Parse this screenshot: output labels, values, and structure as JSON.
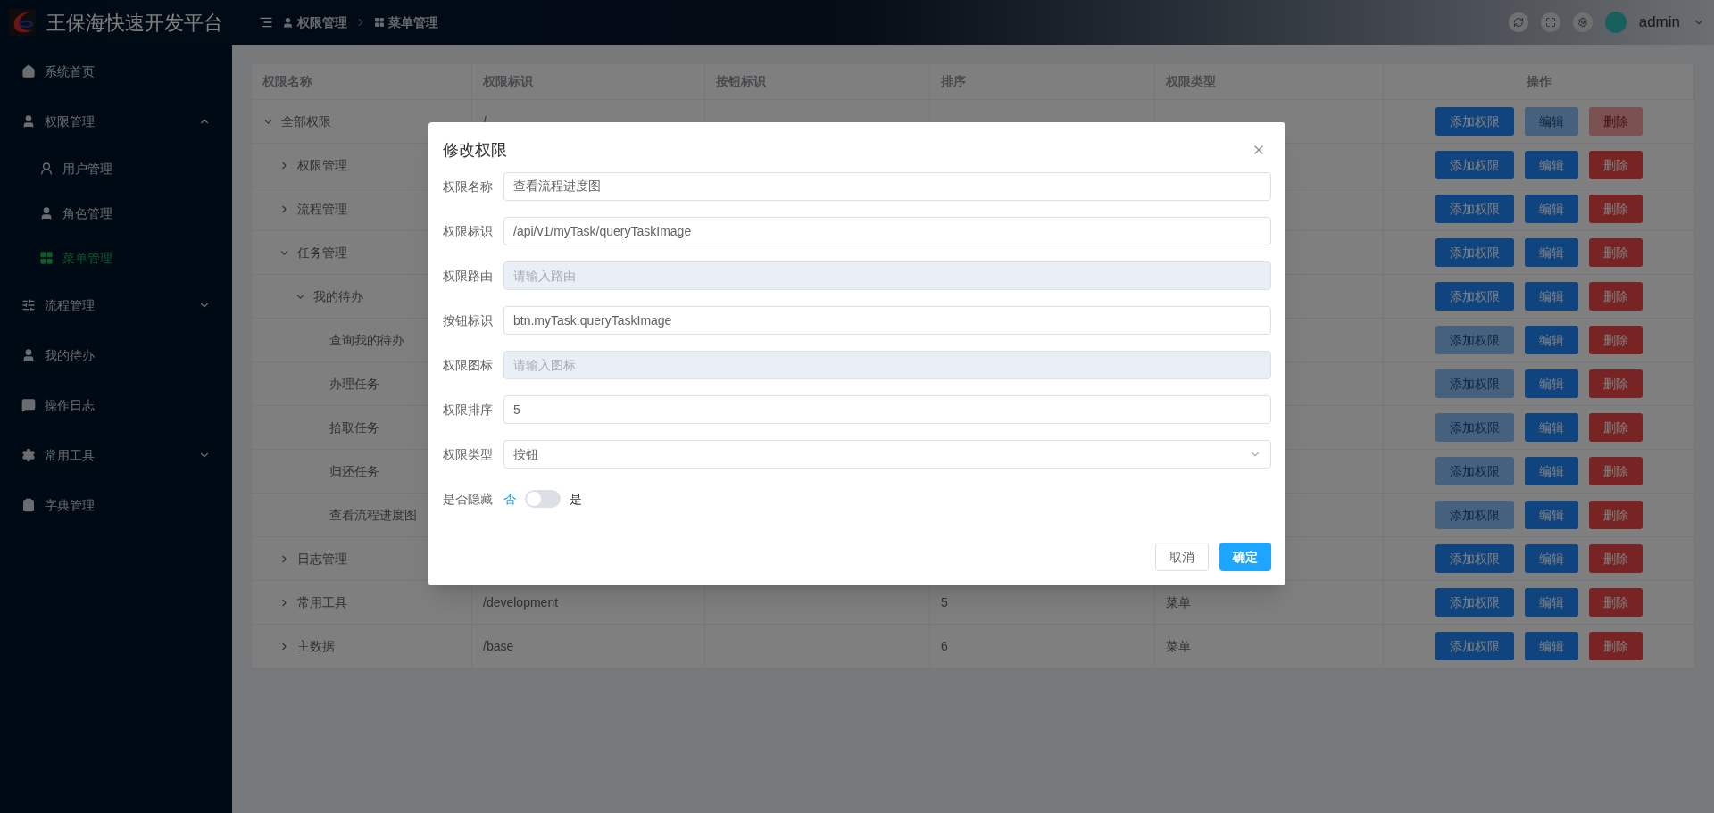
{
  "header": {
    "title": "王保海快速开发平台",
    "breadcrumb": [
      "权限管理",
      "菜单管理"
    ],
    "user": "admin"
  },
  "sidebar": {
    "items": [
      {
        "label": "系统首页",
        "selected": false
      },
      {
        "label": "权限管理",
        "selected": false,
        "expanded": true,
        "children": [
          {
            "label": "用户管理",
            "selected": false
          },
          {
            "label": "角色管理",
            "selected": false
          },
          {
            "label": "菜单管理",
            "selected": true
          }
        ]
      },
      {
        "label": "流程管理",
        "selected": false,
        "expanded": false
      },
      {
        "label": "我的待办",
        "selected": false
      },
      {
        "label": "操作日志",
        "selected": false
      },
      {
        "label": "常用工具",
        "selected": false,
        "expanded": false
      },
      {
        "label": "字典管理",
        "selected": false
      }
    ]
  },
  "table": {
    "columns": [
      "权限名称",
      "权限标识",
      "按钮标识",
      "排序",
      "权限类型",
      "操作"
    ],
    "rows": [
      {
        "name": "全部权限",
        "expanded": true,
        "path": "/",
        "actions": [
          {
            "label": "添加权限",
            "kind": "add",
            "disabled": false
          },
          {
            "label": "编辑",
            "kind": "edit",
            "disabled": true
          },
          {
            "label": "删除",
            "kind": "delete",
            "disabled": true
          }
        ],
        "children": [
          {
            "name": "权限管理",
            "expanded": false,
            "actions": [
              {
                "label": "添加权限",
                "kind": "add",
                "disabled": false
              },
              {
                "label": "编辑",
                "kind": "edit",
                "disabled": false
              },
              {
                "label": "删除",
                "kind": "delete",
                "disabled": false
              }
            ]
          },
          {
            "name": "流程管理",
            "expanded": false,
            "actions": [
              {
                "label": "添加权限",
                "kind": "add",
                "disabled": false
              },
              {
                "label": "编辑",
                "kind": "edit",
                "disabled": false
              },
              {
                "label": "删除",
                "kind": "delete",
                "disabled": false
              }
            ]
          },
          {
            "name": "任务管理",
            "expanded": true,
            "actions": [
              {
                "label": "添加权限",
                "kind": "add",
                "disabled": false
              },
              {
                "label": "编辑",
                "kind": "edit",
                "disabled": false
              },
              {
                "label": "删除",
                "kind": "delete",
                "disabled": false
              }
            ],
            "children": [
              {
                "name": "我的待办",
                "expanded": true,
                "actions": [
                  {
                    "label": "添加权限",
                    "kind": "add",
                    "disabled": false
                  },
                  {
                    "label": "编辑",
                    "kind": "edit",
                    "disabled": false
                  },
                  {
                    "label": "删除",
                    "kind": "delete",
                    "disabled": false
                  }
                ],
                "children": [
                  {
                    "name": "查询我的待办",
                    "actions": [
                      {
                        "label": "添加权限",
                        "kind": "add",
                        "disabled": true
                      },
                      {
                        "label": "编辑",
                        "kind": "edit",
                        "disabled": false
                      },
                      {
                        "label": "删除",
                        "kind": "delete",
                        "disabled": false
                      }
                    ]
                  },
                  {
                    "name": "办理任务",
                    "actions": [
                      {
                        "label": "添加权限",
                        "kind": "add",
                        "disabled": true
                      },
                      {
                        "label": "编辑",
                        "kind": "edit",
                        "disabled": false
                      },
                      {
                        "label": "删除",
                        "kind": "delete",
                        "disabled": false
                      }
                    ]
                  },
                  {
                    "name": "拾取任务",
                    "actions": [
                      {
                        "label": "添加权限",
                        "kind": "add",
                        "disabled": true
                      },
                      {
                        "label": "编辑",
                        "kind": "edit",
                        "disabled": false
                      },
                      {
                        "label": "删除",
                        "kind": "delete",
                        "disabled": false
                      }
                    ]
                  },
                  {
                    "name": "归还任务",
                    "actions": [
                      {
                        "label": "添加权限",
                        "kind": "add",
                        "disabled": true
                      },
                      {
                        "label": "编辑",
                        "kind": "edit",
                        "disabled": false
                      },
                      {
                        "label": "删除",
                        "kind": "delete",
                        "disabled": false
                      }
                    ]
                  },
                  {
                    "name": "查看流程进度图",
                    "actions": [
                      {
                        "label": "添加权限",
                        "kind": "add",
                        "disabled": true
                      },
                      {
                        "label": "编辑",
                        "kind": "edit",
                        "disabled": false
                      },
                      {
                        "label": "删除",
                        "kind": "delete",
                        "disabled": false
                      }
                    ]
                  }
                ]
              }
            ]
          },
          {
            "name": "日志管理",
            "expanded": false,
            "actions": [
              {
                "label": "添加权限",
                "kind": "add",
                "disabled": false
              },
              {
                "label": "编辑",
                "kind": "edit",
                "disabled": false
              },
              {
                "label": "删除",
                "kind": "delete",
                "disabled": false
              }
            ]
          },
          {
            "name": "常用工具",
            "expanded": false,
            "path": "/development",
            "sort": "5",
            "type": "菜单",
            "actions": [
              {
                "label": "添加权限",
                "kind": "add",
                "disabled": false
              },
              {
                "label": "编辑",
                "kind": "edit",
                "disabled": false
              },
              {
                "label": "删除",
                "kind": "delete",
                "disabled": false
              }
            ]
          },
          {
            "name": "主数据",
            "expanded": false,
            "path": "/base",
            "sort": "6",
            "type": "菜单",
            "actions": [
              {
                "label": "添加权限",
                "kind": "add",
                "disabled": false
              },
              {
                "label": "编辑",
                "kind": "edit",
                "disabled": false
              },
              {
                "label": "删除",
                "kind": "delete",
                "disabled": false
              }
            ]
          }
        ]
      }
    ]
  },
  "dialog": {
    "title": "修改权限",
    "fields": [
      {
        "label": "权限名称",
        "kind": "input",
        "value": "查看流程进度图",
        "disabled": false
      },
      {
        "label": "权限标识",
        "kind": "input",
        "value": "/api/v1/myTask/queryTaskImage",
        "disabled": false
      },
      {
        "label": "权限路由",
        "kind": "input",
        "placeholder": "请输入路由",
        "disabled": true
      },
      {
        "label": "按钮标识",
        "kind": "input",
        "value": "btn.myTask.queryTaskImage",
        "disabled": false
      },
      {
        "label": "权限图标",
        "kind": "input",
        "placeholder": "请输入图标",
        "disabled": true
      },
      {
        "label": "权限排序",
        "kind": "input",
        "value": "5",
        "disabled": false
      },
      {
        "label": "权限类型",
        "kind": "select",
        "value": "按钮",
        "disabled": false
      },
      {
        "label": "是否隐藏",
        "kind": "switch",
        "off_text": "否",
        "on_text": "是",
        "on": false
      }
    ],
    "buttons": [
      {
        "label": "取消",
        "kind": "default"
      },
      {
        "label": "确定",
        "kind": "primary"
      }
    ]
  }
}
